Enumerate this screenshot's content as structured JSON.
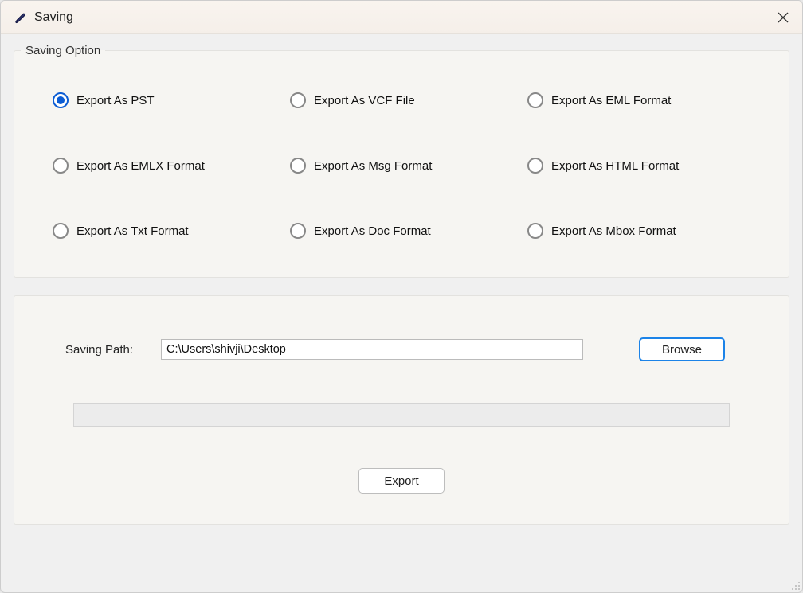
{
  "window": {
    "title": "Saving",
    "icon_name": "brush-icon"
  },
  "group": {
    "legend": "Saving Option",
    "options": [
      {
        "label": "Export As PST",
        "selected": true
      },
      {
        "label": "Export As VCF File",
        "selected": false
      },
      {
        "label": "Export As EML Format",
        "selected": false
      },
      {
        "label": "Export As EMLX Format",
        "selected": false
      },
      {
        "label": "Export As Msg Format",
        "selected": false
      },
      {
        "label": "Export As HTML Format",
        "selected": false
      },
      {
        "label": "Export As Txt Format",
        "selected": false
      },
      {
        "label": "Export As Doc Format",
        "selected": false
      },
      {
        "label": "Export As Mbox Format",
        "selected": false
      }
    ]
  },
  "saving_path": {
    "label": "Saving Path:",
    "value": "C:\\Users\\shivji\\Desktop"
  },
  "buttons": {
    "browse": "Browse",
    "export": "Export"
  },
  "progress": {
    "percent": 0
  }
}
